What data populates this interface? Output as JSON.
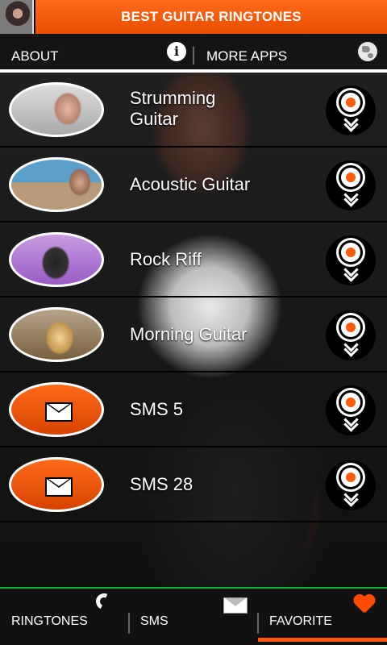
{
  "header": {
    "title": "BEST GUITAR RINGTONES"
  },
  "subnav": {
    "about_label": "ABOUT",
    "info_icon": "i",
    "more_apps_label": "MORE APPS"
  },
  "ringtones": [
    {
      "label_line1": "Strumming",
      "label_line2": "Guitar",
      "thumb": "photo"
    },
    {
      "label": "Acoustic Guitar",
      "thumb": "photo"
    },
    {
      "label": "Rock Riff",
      "thumb": "photo"
    },
    {
      "label": "Morning Guitar",
      "thumb": "photo"
    },
    {
      "label": "SMS 5",
      "thumb": "envelope-icon"
    },
    {
      "label": "SMS 28",
      "thumb": "envelope-icon"
    }
  ],
  "tabs": [
    {
      "label": "RINGTONES",
      "icon": "phone-icon"
    },
    {
      "label": "SMS",
      "icon": "envelope-icon"
    },
    {
      "label": "FAVORITE",
      "icon": "heart-icon",
      "active": true
    }
  ],
  "colors": {
    "accent": "#ff5a0a",
    "active_line": "#0ab33a"
  }
}
